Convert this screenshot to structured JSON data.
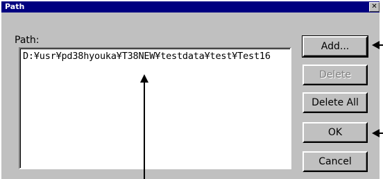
{
  "window": {
    "title": "Path",
    "close_glyph": "✕"
  },
  "path_list": {
    "label": "Path:",
    "items": [
      "D:¥usr¥pd38hyouka¥T38NEW¥testdata¥test¥Test16"
    ]
  },
  "buttons": {
    "add": "Add...",
    "delete": "Delete",
    "delete_all": "Delete All",
    "ok": "OK",
    "cancel": "Cancel"
  },
  "icons": {
    "close": "close-icon",
    "annotation_arrows": "arrow-icon"
  }
}
